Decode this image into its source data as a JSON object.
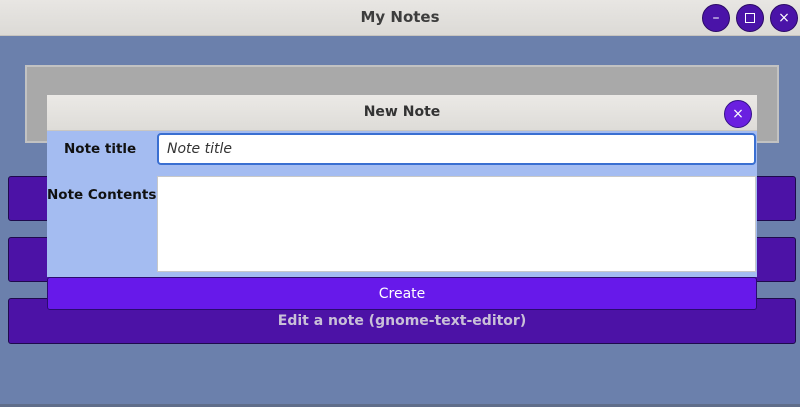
{
  "window": {
    "title": "My Notes",
    "controls": {
      "minimize": "–",
      "close": "×"
    }
  },
  "main": {
    "buttons": [
      {
        "label": ""
      },
      {
        "label": ""
      },
      {
        "label": "Edit a note (gnome-text-editor)"
      }
    ]
  },
  "dialog": {
    "title": "New Note",
    "close": "×",
    "title_label": "Note title",
    "title_placeholder": "Note title",
    "contents_label": "Note Contents",
    "create_label": "Create"
  },
  "colors": {
    "background": "#6b80ac",
    "accent": "#4c12a6",
    "dialog_body": "#a4bcf1",
    "create_button": "#6719ea"
  }
}
